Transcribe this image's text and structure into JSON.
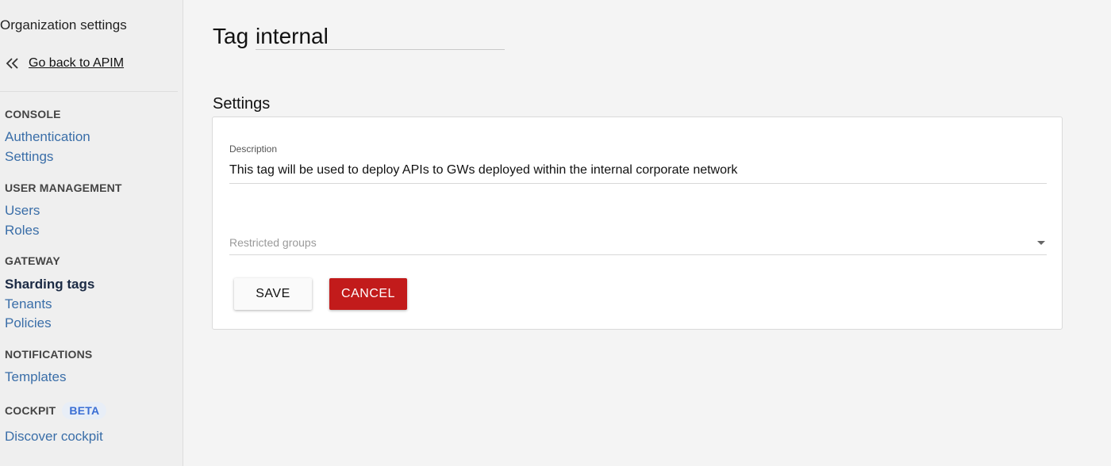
{
  "sidebar": {
    "org_title": "Organization settings",
    "back_label": "Go back to APIM",
    "sections": {
      "console": {
        "title": "CONSOLE",
        "items": [
          "Authentication",
          "Settings"
        ]
      },
      "user_management": {
        "title": "USER MANAGEMENT",
        "items": [
          "Users",
          "Roles"
        ]
      },
      "gateway": {
        "title": "GATEWAY",
        "items": [
          "Sharding tags",
          "Tenants",
          "Policies"
        ],
        "active": "Sharding tags"
      },
      "notifications": {
        "title": "NOTIFICATIONS",
        "items": [
          "Templates"
        ]
      },
      "cockpit": {
        "title": "COCKPIT",
        "badge": "BETA",
        "items": [
          "Discover cockpit"
        ]
      }
    }
  },
  "main": {
    "title_prefix": "Tag",
    "tag_name": "internal",
    "settings_heading": "Settings",
    "description_label": "Description",
    "description_value": "This tag will be used to deploy APIs to GWs deployed within the internal corporate network",
    "restricted_groups_placeholder": "Restricted groups",
    "save_label": "SAVE",
    "cancel_label": "CANCEL"
  },
  "colors": {
    "link": "#3a6ea8",
    "active_nav": "#1b2a44",
    "cancel_button": "#c21b1b",
    "beta_badge_text": "#3a6ed4"
  },
  "icons": {
    "back": "double-chevron-left-icon",
    "select_caret": "caret-down-icon"
  }
}
